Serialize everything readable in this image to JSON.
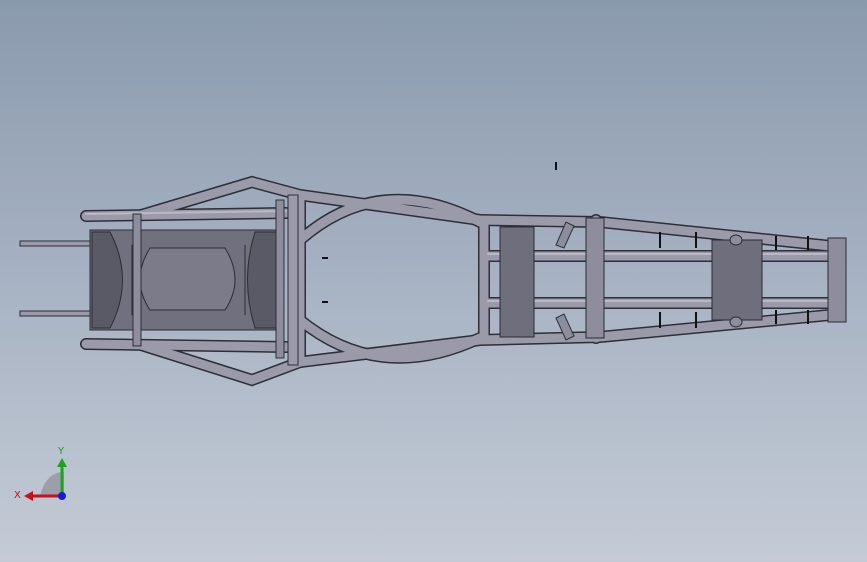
{
  "viewport": {
    "background_top": "#8a9aad",
    "background_bottom": "#c4cbd6"
  },
  "model": {
    "tube_fill": "#8f8fa1",
    "tube_stroke": "#333340",
    "plate_fill": "#6e6e7c",
    "plate_dark": "#5a5a66"
  },
  "triad": {
    "x_label": "X",
    "y_label": "Y",
    "x_color": "#c2121a",
    "y_color": "#1aa51a",
    "z_color": "#1a1ad0"
  }
}
